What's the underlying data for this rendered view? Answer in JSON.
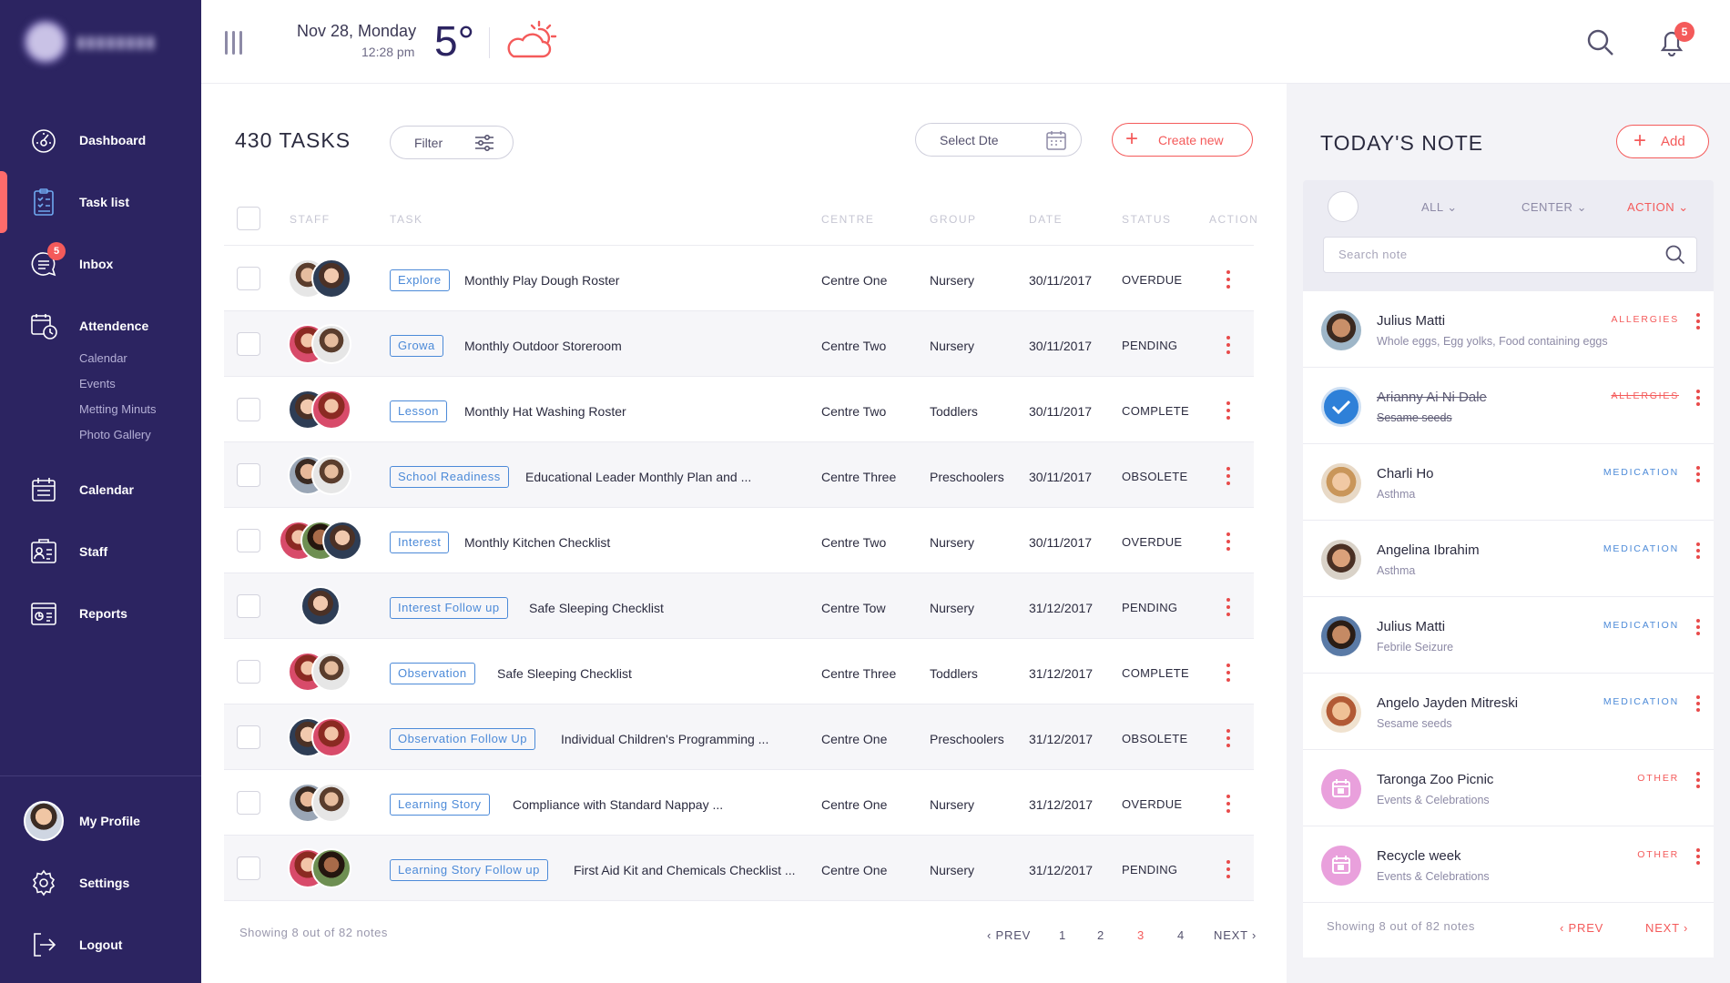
{
  "topbar": {
    "date": "Nov 28, Monday",
    "time": "12:28 pm",
    "temperature": "5°",
    "weather_icon": "partly-cloudy-icon",
    "notification_count": "5"
  },
  "sidebar": {
    "items": [
      {
        "label": "Dashboard",
        "icon": "dashboard-icon"
      },
      {
        "label": "Task list",
        "icon": "task-list-icon"
      },
      {
        "label": "Inbox",
        "icon": "inbox-icon",
        "badge": "5"
      },
      {
        "label": "Attendence",
        "icon": "attendance-icon"
      },
      {
        "label": "Calendar",
        "icon": "calendar-icon"
      },
      {
        "label": "Staff",
        "icon": "staff-icon"
      },
      {
        "label": "Reports",
        "icon": "reports-icon"
      }
    ],
    "attendance_sub": [
      "Calendar",
      "Events",
      "Metting Minuts",
      "Photo Gallery"
    ],
    "bottom": [
      {
        "label": "My Profile"
      },
      {
        "label": "Settings",
        "icon": "gear-icon"
      },
      {
        "label": "Logout",
        "icon": "logout-icon"
      }
    ]
  },
  "tasks": {
    "title": "430 TASKS",
    "filter_label": "Filter",
    "select_date_label": "Select Dte",
    "create_label": "Create new",
    "columns": [
      "STAFF",
      "TASK",
      "CENTRE",
      "GROUP",
      "DATE",
      "STATUS",
      "ACTION"
    ],
    "rows": [
      {
        "tag": "Explore",
        "task": "Monthly Play Dough Roster",
        "centre": "Centre One",
        "group": "Nursery",
        "date": "30/11/2017",
        "status": "OVERDUE"
      },
      {
        "tag": "Growa",
        "task": "Monthly Outdoor Storeroom",
        "centre": "Centre Two",
        "group": "Nursery",
        "date": "30/11/2017",
        "status": "PENDING"
      },
      {
        "tag": "Lesson",
        "task": "Monthly Hat Washing Roster",
        "centre": "Centre Two",
        "group": "Toddlers",
        "date": "30/11/2017",
        "status": "COMPLETE"
      },
      {
        "tag": "School Readiness",
        "task": "Educational Leader Monthly Plan and ...",
        "centre": "Centre Three",
        "group": "Preschoolers",
        "date": "30/11/2017",
        "status": "OBSOLETE"
      },
      {
        "tag": "Interest",
        "task": "Monthly Kitchen Checklist",
        "centre": "Centre Two",
        "group": "Nursery",
        "date": "30/11/2017",
        "status": "OVERDUE"
      },
      {
        "tag": "Interest Follow up",
        "task": "Safe Sleeping Checklist",
        "centre": "Centre Tow",
        "group": "Nursery",
        "date": "31/12/2017",
        "status": "PENDING"
      },
      {
        "tag": "Observation",
        "task": "Safe Sleeping Checklist",
        "centre": "Centre Three",
        "group": "Toddlers",
        "date": "31/12/2017",
        "status": "COMPLETE"
      },
      {
        "tag": "Observation Follow Up",
        "task": "Individual Children's Programming ...",
        "centre": "Centre One",
        "group": "Preschoolers",
        "date": "31/12/2017",
        "status": "OBSOLETE"
      },
      {
        "tag": "Learning Story",
        "task": "Compliance with Standard Nappay  ...",
        "centre": "Centre One",
        "group": "Nursery",
        "date": "31/12/2017",
        "status": "OVERDUE"
      },
      {
        "tag": "Learning Story Follow up",
        "task": "First Aid Kit and Chemicals Checklist ...",
        "centre": "Centre One",
        "group": "Nursery",
        "date": "31/12/2017",
        "status": "PENDING"
      }
    ],
    "showing": "Showing 8 out of 82 notes",
    "pagination": {
      "prev": "PREV",
      "pages": [
        "1",
        "2",
        "3",
        "4"
      ],
      "current": "3",
      "next": "NEXT"
    }
  },
  "notes": {
    "title": "TODAY'S NOTE",
    "add_label": "Add",
    "filters": [
      "ALL",
      "CENTER",
      "ACTION"
    ],
    "search_placeholder": "Search note",
    "items": [
      {
        "name": "Julius Matti",
        "detail": "Whole eggs, Egg yolks, Food containing eggs",
        "category": "ALLERGIES"
      },
      {
        "name": "Arianny Ai Ni Dale",
        "detail": "Sesame seeds",
        "category": "ALLERGIES",
        "done": true
      },
      {
        "name": "Charli Ho",
        "detail": "Asthma",
        "category": "MEDICATION"
      },
      {
        "name": "Angelina Ibrahim",
        "detail": "Asthma",
        "category": "MEDICATION"
      },
      {
        "name": "Julius Matti",
        "detail": "Febrile Seizure",
        "category": "MEDICATION"
      },
      {
        "name": "Angelo Jayden Mitreski",
        "detail": "Sesame seeds",
        "category": "MEDICATION"
      },
      {
        "name": "Taronga Zoo Picnic",
        "detail": "Events & Celebrations",
        "category": "OTHER"
      },
      {
        "name": "Recycle week",
        "detail": "Events & Celebrations",
        "category": "OTHER"
      }
    ],
    "showing": "Showing 8 out of 82 notes",
    "pagination": {
      "prev": "PREV",
      "next": "NEXT"
    }
  },
  "colors": {
    "sidebar": "#2c2461",
    "accent": "#f45a5a",
    "tag_blue": "#4c8ad8"
  }
}
